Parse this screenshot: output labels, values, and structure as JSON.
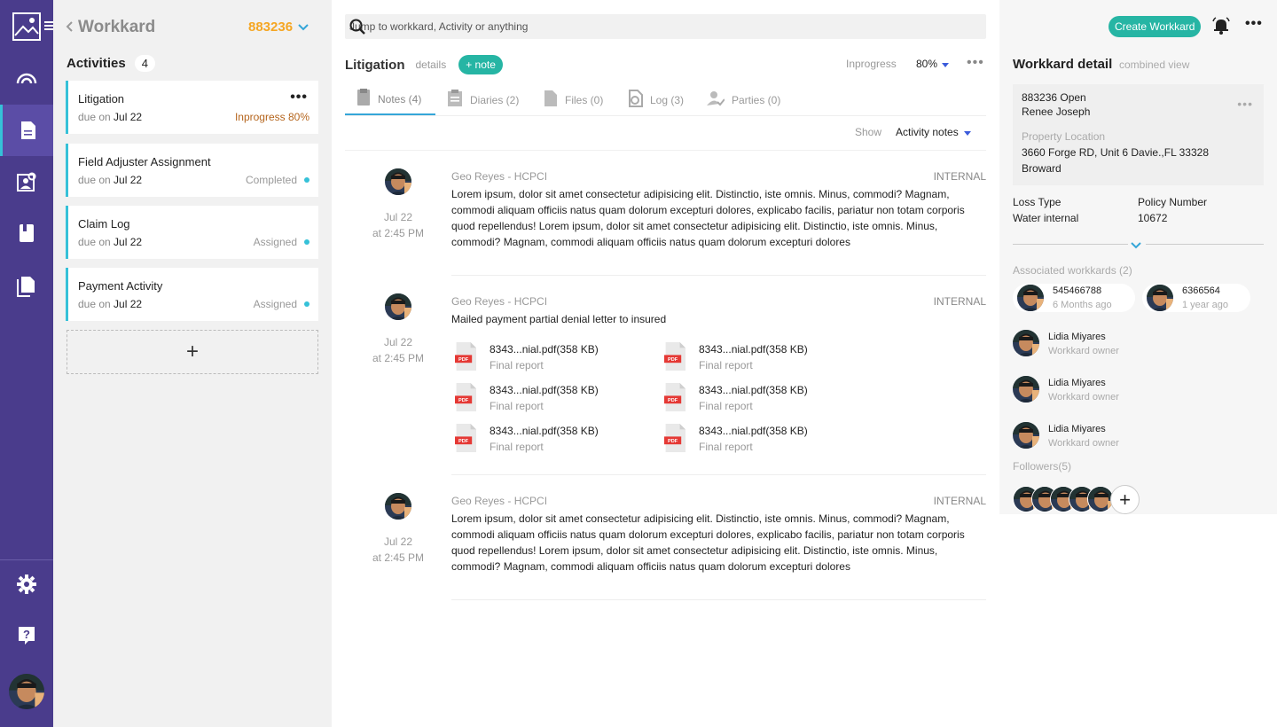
{
  "rail": {
    "icons": [
      "image-logo-icon",
      "menu-icon",
      "dashboard-icon",
      "document-icon",
      "search-profile-icon",
      "book-icon",
      "files-icon",
      "gear-icon",
      "help-icon"
    ],
    "accent": "#4a3c8c"
  },
  "workkard": {
    "back_title": "Workkard",
    "number": "883236"
  },
  "activities": {
    "title": "Activities",
    "count": "4",
    "items": [
      {
        "name": "Litigation",
        "due_label": "due on",
        "due": "Jul 22",
        "status": "Inprogress 80%"
      },
      {
        "name": "Field Adjuster Assignment",
        "due_label": "due on",
        "due": "Jul 22",
        "status": "Completed"
      },
      {
        "name": "Claim Log",
        "due_label": "due on",
        "due": "Jul 22",
        "status": "Assigned"
      },
      {
        "name": "Payment Activity",
        "due_label": "due on",
        "due": "Jul 22",
        "status": "Assigned"
      }
    ],
    "add_label": "+"
  },
  "search": {
    "placeholder": "Jump to workkard, Activity or anything"
  },
  "litigation": {
    "title": "Litigation",
    "details": "details",
    "note_btn": "+ note",
    "status": "Inprogress",
    "percent": "80%"
  },
  "tabs": [
    {
      "label": "Notes (4)"
    },
    {
      "label": "Diaries (2)"
    },
    {
      "label": "Files (0)"
    },
    {
      "label": "Log (3)"
    },
    {
      "label": "Parties (0)"
    }
  ],
  "show": {
    "label": "Show",
    "value": "Activity notes"
  },
  "notes": [
    {
      "author": "Geo Reyes - HCPCI",
      "tag": "INTERNAL",
      "date": "Jul 22",
      "time": "at 2:45 PM",
      "body": "Lorem ipsum, dolor sit amet consectetur adipisicing elit. Distinctio, iste omnis. Minus, commodi? Magnam, commodi aliquam officiis natus quam dolorum excepturi dolores, explicabo facilis, pariatur non totam corporis quod repellendus! Lorem ipsum, dolor sit amet consectetur adipisicing elit. Distinctio, iste omnis. Minus, commodi? Magnam, commodi aliquam officiis natus quam dolorum excepturi dolores"
    },
    {
      "author": "Geo Reyes - HCPCI",
      "tag": "INTERNAL",
      "date": "Jul 22",
      "time": "at 2:45 PM",
      "body": "Mailed payment partial denial letter to insured",
      "files": [
        {
          "name": "8343...nial.pdf(358 KB)",
          "desc": "Final report",
          "badge": "PDF"
        },
        {
          "name": "8343...nial.pdf(358 KB)",
          "desc": "Final report",
          "badge": "PDF"
        },
        {
          "name": "8343...nial.pdf(358 KB)",
          "desc": "Final report",
          "badge": "PDF"
        },
        {
          "name": "8343...nial.pdf(358 KB)",
          "desc": "Final report",
          "badge": "PDF"
        },
        {
          "name": "8343...nial.pdf(358 KB)",
          "desc": "Final report",
          "badge": "PDF"
        },
        {
          "name": "8343...nial.pdf(358 KB)",
          "desc": "Final report",
          "badge": "PDF"
        }
      ]
    },
    {
      "author": "Geo Reyes - HCPCI",
      "tag": "INTERNAL",
      "date": "Jul 22",
      "time": "at 2:45 PM",
      "body": "Lorem ipsum, dolor sit amet consectetur adipisicing elit. Distinctio, iste omnis. Minus, commodi? Magnam, commodi aliquam officiis natus quam dolorum excepturi dolores, explicabo facilis, pariatur non totam corporis quod repellendus! Lorem ipsum, dolor sit amet consectetur adipisicing elit. Distinctio, iste omnis. Minus, commodi? Magnam, commodi aliquam officiis natus quam dolorum excepturi dolores"
    }
  ],
  "header_right": {
    "create_btn": "Create Workkard"
  },
  "detail": {
    "title": "Workkard detail",
    "subtitle": "combined view",
    "line1": "883236 Open",
    "line2": "Renee Joseph",
    "property_label": "Property Location",
    "address1": "3660 Forge RD, Unit 6 Davie.,FL 33328",
    "address2": "Broward",
    "loss_type_label": "Loss Type",
    "loss_type": "Water internal",
    "policy_label": "Policy Number",
    "policy": "10672"
  },
  "associated": {
    "title": "Associated workkards (2)",
    "items": [
      {
        "number": "545466788",
        "time": "6 Months ago"
      },
      {
        "number": "6366564",
        "time": "1 year ago"
      }
    ]
  },
  "owners": [
    {
      "name": "Lidia Miyares",
      "role": "Workkard owner"
    },
    {
      "name": "Lidia Miyares",
      "role": "Workkard owner"
    },
    {
      "name": "Lidia Miyares",
      "role": "Workkard owner"
    }
  ],
  "followers": {
    "title": "Followers(5)",
    "add": "+"
  },
  "colors": {
    "teal": "#26b5a4",
    "cyan": "#35c1d8",
    "orange": "#f5a623",
    "pdf_red": "#e53935"
  }
}
